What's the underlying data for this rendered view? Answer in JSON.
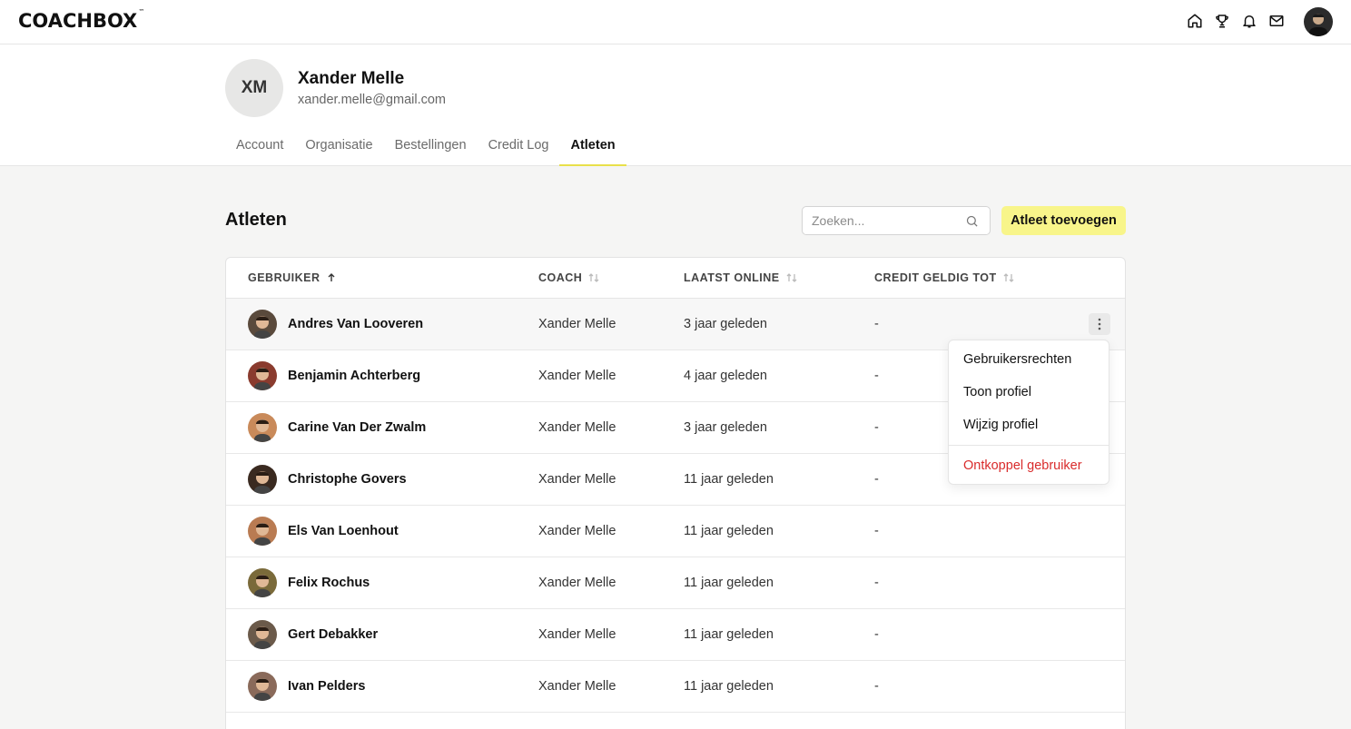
{
  "app": {
    "logo": "COACHBOX",
    "logo_tm": "™"
  },
  "topbar": {
    "icons": [
      "home-icon",
      "trophy-icon",
      "bell-icon",
      "mail-icon"
    ]
  },
  "profile": {
    "initials": "XM",
    "name": "Xander Melle",
    "email": "xander.melle@gmail.com"
  },
  "tabs": [
    {
      "label": "Account",
      "active": false
    },
    {
      "label": "Organisatie",
      "active": false
    },
    {
      "label": "Bestellingen",
      "active": false
    },
    {
      "label": "Credit Log",
      "active": false
    },
    {
      "label": "Atleten",
      "active": true
    }
  ],
  "section": {
    "title": "Atleten",
    "search_placeholder": "Zoeken...",
    "add_button": "Atleet toevoegen"
  },
  "table": {
    "columns": [
      "GEBRUIKER",
      "COACH",
      "LAATST ONLINE",
      "CREDIT GELDIG TOT"
    ],
    "rows": [
      {
        "name": "Andres Van Looveren",
        "coach": "Xander Melle",
        "last_online": "3 jaar geleden",
        "credit": "-",
        "avatar_color": "#5a4a3c"
      },
      {
        "name": "Benjamin Achterberg",
        "coach": "Xander Melle",
        "last_online": "4 jaar geleden",
        "credit": "-",
        "avatar_color": "#8a3b2e"
      },
      {
        "name": "Carine Van Der Zwalm",
        "coach": "Xander Melle",
        "last_online": "3 jaar geleden",
        "credit": "-",
        "avatar_color": "#c98a5a"
      },
      {
        "name": "Christophe Govers",
        "coach": "Xander Melle",
        "last_online": "11 jaar geleden",
        "credit": "-",
        "avatar_color": "#3a2a20"
      },
      {
        "name": "Els Van Loenhout",
        "coach": "Xander Melle",
        "last_online": "11 jaar geleden",
        "credit": "-",
        "avatar_color": "#b97b52"
      },
      {
        "name": "Felix Rochus",
        "coach": "Xander Melle",
        "last_online": "11 jaar geleden",
        "credit": "-",
        "avatar_color": "#7a6a3a"
      },
      {
        "name": "Gert Debakker",
        "coach": "Xander Melle",
        "last_online": "11 jaar geleden",
        "credit": "-",
        "avatar_color": "#6b5a4a"
      },
      {
        "name": "Ivan Pelders",
        "coach": "Xander Melle",
        "last_online": "11 jaar geleden",
        "credit": "-",
        "avatar_color": "#8a6a5a"
      }
    ]
  },
  "context_menu": {
    "items": [
      "Gebruikersrechten",
      "Toon profiel",
      "Wijzig profiel"
    ],
    "danger_item": "Ontkoppel gebruiker"
  },
  "colors": {
    "accent": "#f8f58a",
    "tab_underline": "#e8e04a",
    "danger": "#d92b2b"
  }
}
